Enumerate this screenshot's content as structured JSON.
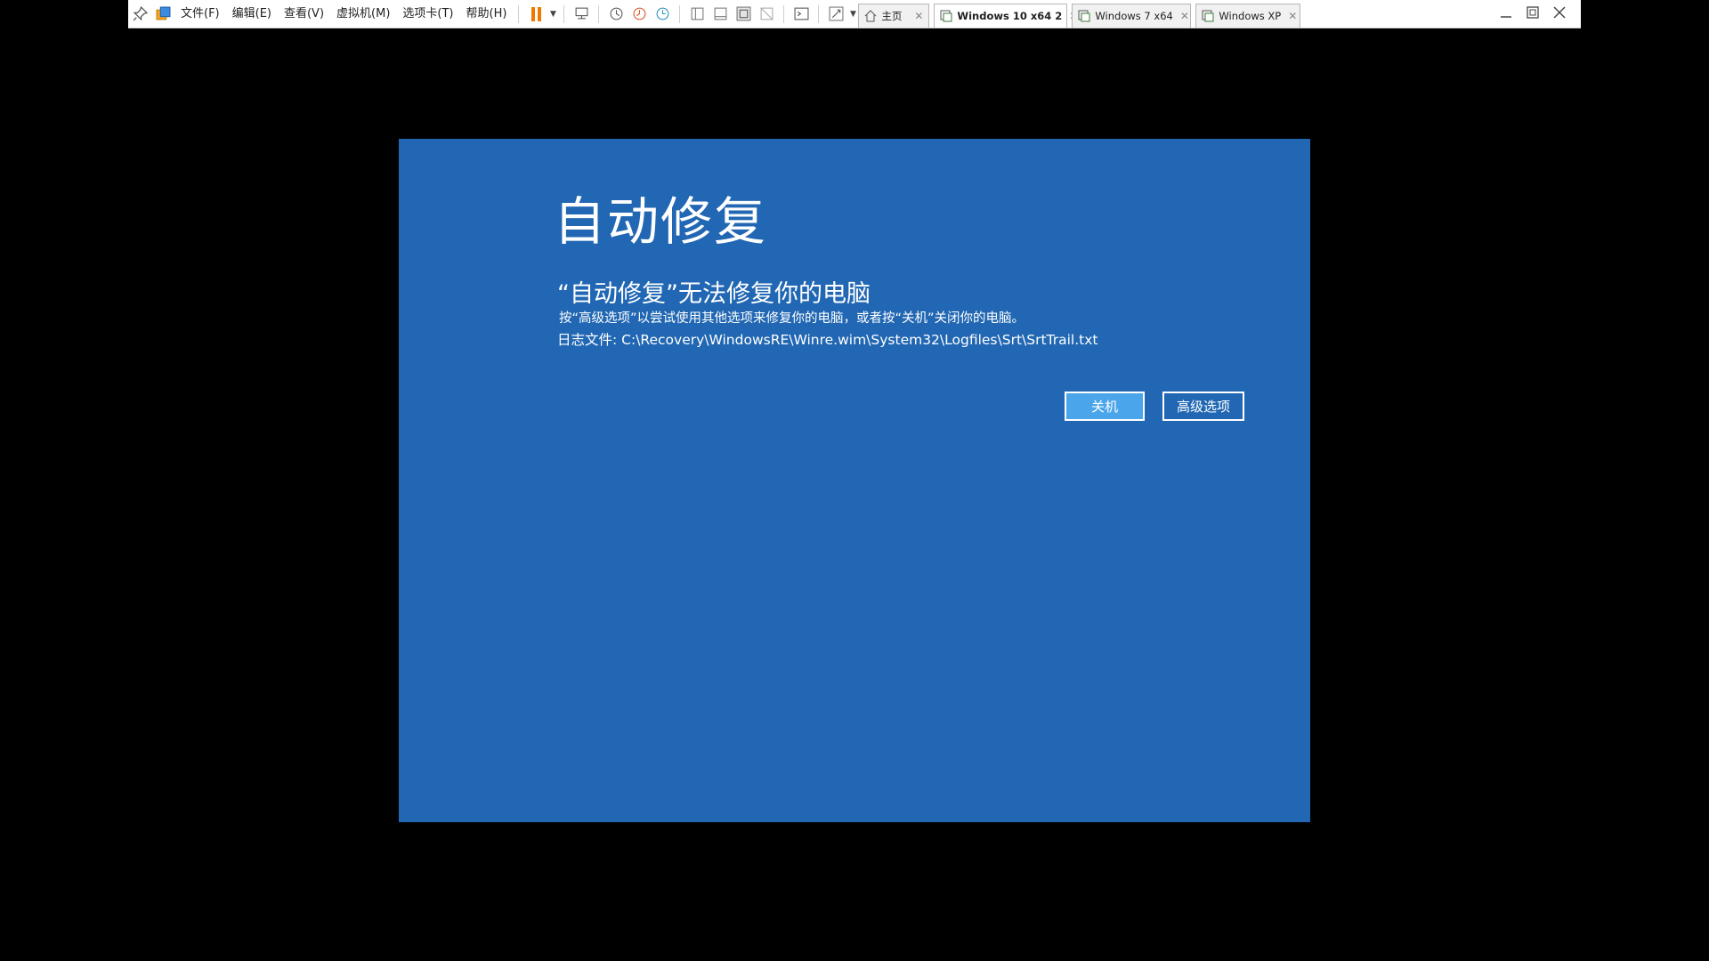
{
  "toolbar": {
    "menu": [
      {
        "label": "文件(F)"
      },
      {
        "label": "编辑(E)"
      },
      {
        "label": "查看(V)"
      },
      {
        "label": "虚拟机(M)"
      },
      {
        "label": "选项卡(T)"
      },
      {
        "label": "帮助(H)"
      }
    ],
    "tabs": [
      {
        "label": "主页",
        "active": false
      },
      {
        "label": "Windows 10 x64 2",
        "active": true
      },
      {
        "label": "Windows 7 x64",
        "active": false
      },
      {
        "label": "Windows XP",
        "active": false
      }
    ],
    "tab_close_glyph": "✕",
    "pause_color": "#f07a00"
  },
  "guest": {
    "background_color": "#2167b3",
    "title": "自动修复",
    "subtitle": "“自动修复”无法修复你的电脑",
    "description": "按“高级选项”以尝试使用其他选项来修复你的电脑，或者按“关机”关闭你的电脑。",
    "log_line": "日志文件: C:\\Recovery\\WindowsRE\\Winre.wim\\System32\\Logfiles\\Srt\\SrtTrail.txt",
    "buttons": {
      "shutdown": "关机",
      "advanced": "高级选项"
    }
  }
}
